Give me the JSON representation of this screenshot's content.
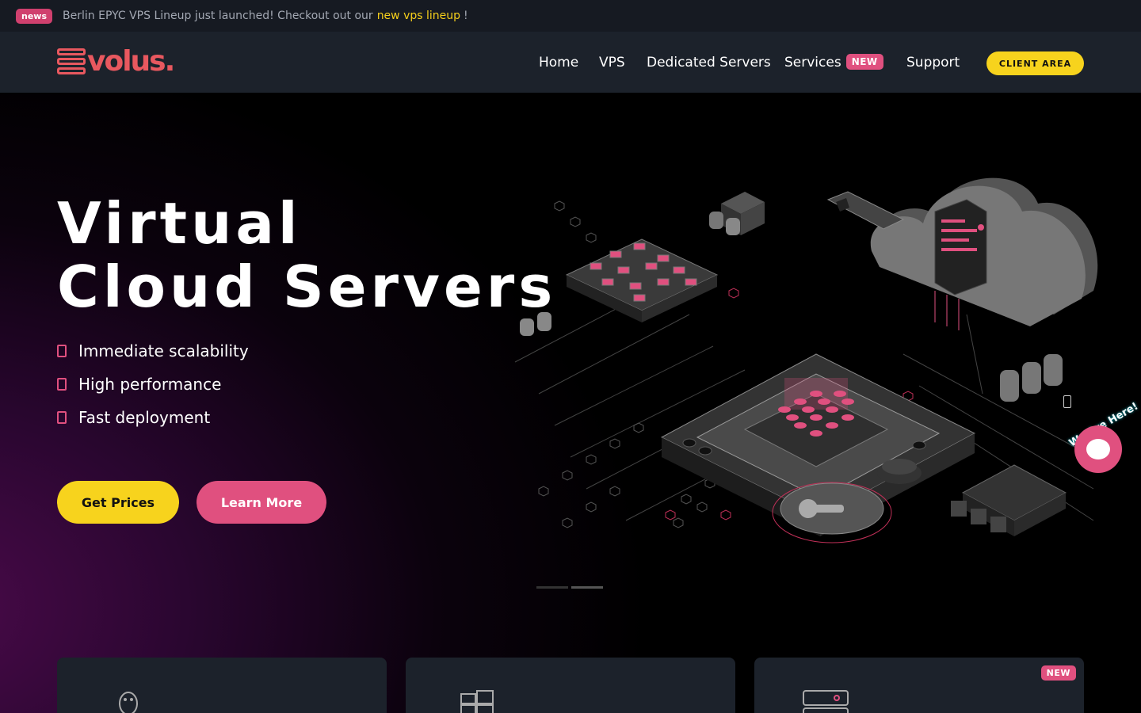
{
  "news": {
    "badge": "news",
    "text": "Berlin EPYC VPS Lineup just launched! Checkout out our",
    "link": "new vps lineup ",
    "end": "!"
  },
  "brand": {
    "logo_text": "volus.",
    "accent": "#e8585f"
  },
  "nav": {
    "home": "Home",
    "vps": "VPS",
    "dedicated": "Dedicated Servers",
    "services": "Services",
    "services_badge": "NEW",
    "support": "Support",
    "client_area": "CLIENT AREA "
  },
  "hero": {
    "title_line1": "Virtual",
    "title_line2": "Cloud Servers",
    "features": [
      "Immediate scalability",
      "High performance",
      "Fast deployment"
    ],
    "btn_prices": "Get Prices",
    "btn_learn": "Learn More",
    "slides_total": 2,
    "slide_active": 2
  },
  "chat": {
    "label": "We Are Here!"
  },
  "cards": [
    {
      "icon": "linux-icon",
      "badge": ""
    },
    {
      "icon": "windows-icon",
      "badge": ""
    },
    {
      "icon": "server-icon",
      "badge": "NEW"
    }
  ],
  "colors": {
    "yellow": "#f7d31d",
    "pink": "#e0507f",
    "header_bg": "#1c222b",
    "news_bg": "#161a22"
  }
}
